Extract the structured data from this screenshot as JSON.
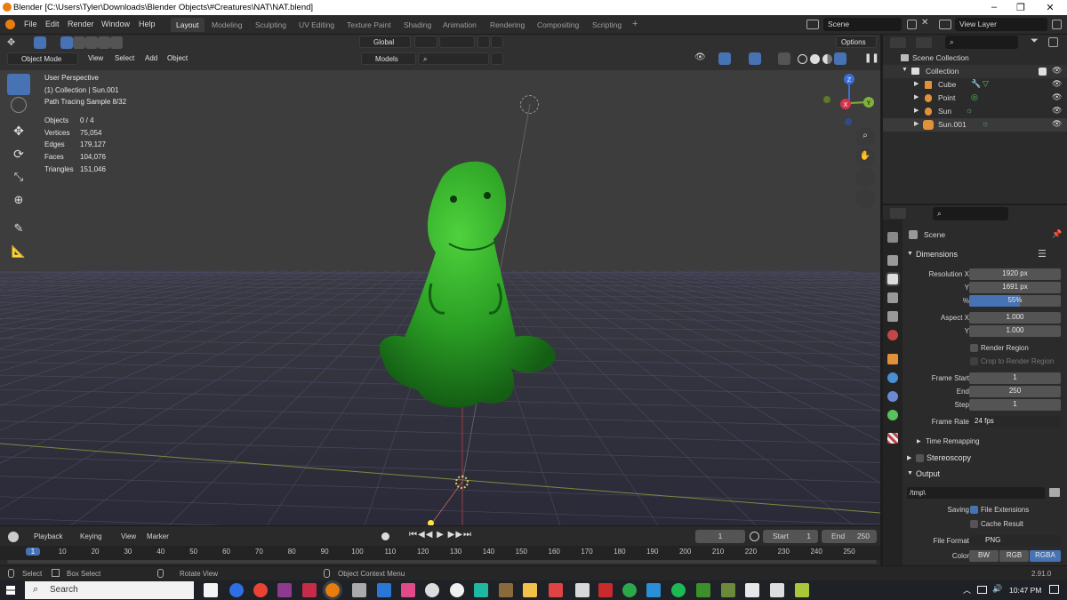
{
  "window": {
    "title": "Blender [C:\\Users\\Tyler\\Downloads\\Blender Objects\\#Creatures\\NAT\\NAT.blend]"
  },
  "menu": {
    "items": [
      "File",
      "Edit",
      "Render",
      "Window",
      "Help"
    ]
  },
  "workspaces": [
    "Layout",
    "Modeling",
    "Sculpting",
    "UV Editing",
    "Texture Paint",
    "Shading",
    "Animation",
    "Rendering",
    "Compositing",
    "Scripting"
  ],
  "add_tab": "+",
  "scene_field": "Scene",
  "view_layer_field": "View Layer",
  "viewport_header": {
    "mode": "Object Mode",
    "menus": [
      "View",
      "Select",
      "Add",
      "Object"
    ],
    "orientation": "Global",
    "models": "Models",
    "options": "Options"
  },
  "overlay_info": {
    "perspective": "User Perspective",
    "collection": "(1) Collection | Sun.001",
    "render": "Path Tracing Sample 8/32"
  },
  "stats": [
    {
      "label": "Objects",
      "value": "0 / 4"
    },
    {
      "label": "Vertices",
      "value": "75,054"
    },
    {
      "label": "Edges",
      "value": "179,127"
    },
    {
      "label": "Faces",
      "value": "104,076"
    },
    {
      "label": "Triangles",
      "value": "151,046"
    }
  ],
  "gizmo_axes": {
    "x": "X",
    "y": "Y",
    "z": "Z"
  },
  "timeline": {
    "menus": [
      "Playback",
      "Keying",
      "View",
      "Marker"
    ],
    "current_frame": "1",
    "start_label": "Start",
    "start": "1",
    "end_label": "End",
    "end": "250",
    "ruler": [
      "1",
      "10",
      "20",
      "30",
      "40",
      "50",
      "60",
      "70",
      "80",
      "90",
      "100",
      "110",
      "120",
      "130",
      "140",
      "150",
      "160",
      "170",
      "180",
      "190",
      "200",
      "210",
      "220",
      "230",
      "240",
      "250"
    ]
  },
  "status": {
    "select": "Select",
    "box_select": "Box Select",
    "rotate": "Rotate View",
    "context_menu": "Object Context Menu",
    "version": "2.91.0"
  },
  "outliner": {
    "root": "Scene Collection",
    "collection": "Collection",
    "items": [
      "Cube",
      "Point",
      "Sun",
      "Sun.001"
    ]
  },
  "properties": {
    "scene": "Scene",
    "dimensions": "Dimensions",
    "res_x_label": "Resolution X",
    "res_x": "1920 px",
    "res_y_label": "Y",
    "res_y": "1691 px",
    "pct_label": "%",
    "pct": "55%",
    "pct_fill": 0.55,
    "aspect_x_label": "Aspect X",
    "aspect_x": "1.000",
    "aspect_y_label": "Y",
    "aspect_y": "1.000",
    "render_region": "Render Region",
    "crop_region": "Crop to Render Region",
    "frame_start_label": "Frame Start",
    "frame_start": "1",
    "end_label": "End",
    "end": "250",
    "step_label": "Step",
    "step": "1",
    "frame_rate_label": "Frame Rate",
    "frame_rate": "24 fps",
    "time_remapping": "Time Remapping",
    "stereoscopy": "Stereoscopy",
    "output": "Output",
    "output_path": "/tmp\\",
    "saving_label": "Saving",
    "file_extensions": "File Extensions",
    "cache_result": "Cache Result",
    "file_format_label": "File Format",
    "file_format": "PNG",
    "color_label": "Color",
    "color_opts": [
      "BW",
      "RGB",
      "RGBA"
    ]
  },
  "taskbar": {
    "search": "Search",
    "time": "10:47 PM"
  },
  "colors": {
    "accent": "#4772b3",
    "active_tab": "#3b3b3b",
    "dino": "#2f9e2a"
  }
}
